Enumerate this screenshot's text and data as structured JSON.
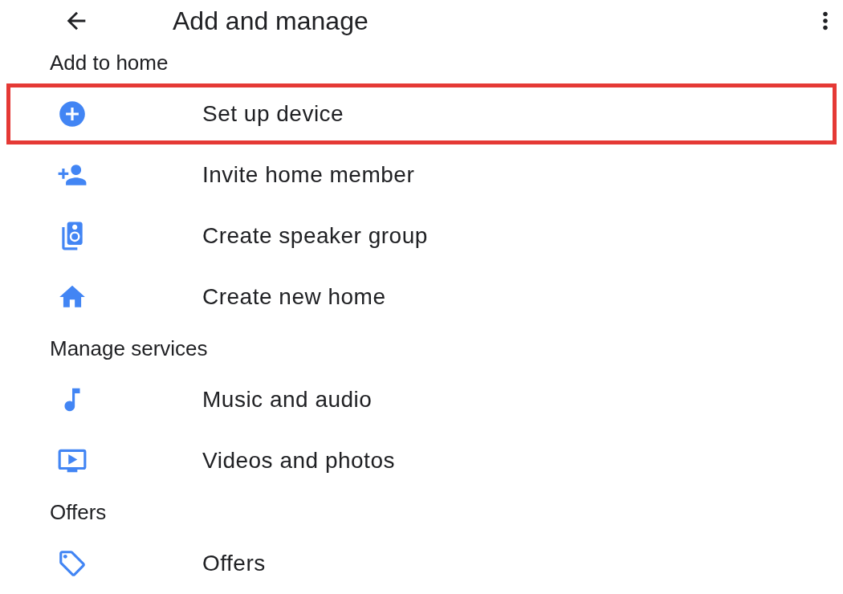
{
  "header": {
    "title": "Add and manage"
  },
  "sections": [
    {
      "title": "Add to home",
      "items": [
        {
          "label": "Set up device",
          "highlighted": true
        },
        {
          "label": "Invite home member",
          "highlighted": false
        },
        {
          "label": "Create speaker group",
          "highlighted": false
        },
        {
          "label": "Create new home",
          "highlighted": false
        }
      ]
    },
    {
      "title": "Manage services",
      "items": [
        {
          "label": "Music and audio",
          "highlighted": false
        },
        {
          "label": "Videos and photos",
          "highlighted": false
        }
      ]
    },
    {
      "title": "Offers",
      "items": [
        {
          "label": "Offers",
          "highlighted": false
        }
      ]
    }
  ]
}
